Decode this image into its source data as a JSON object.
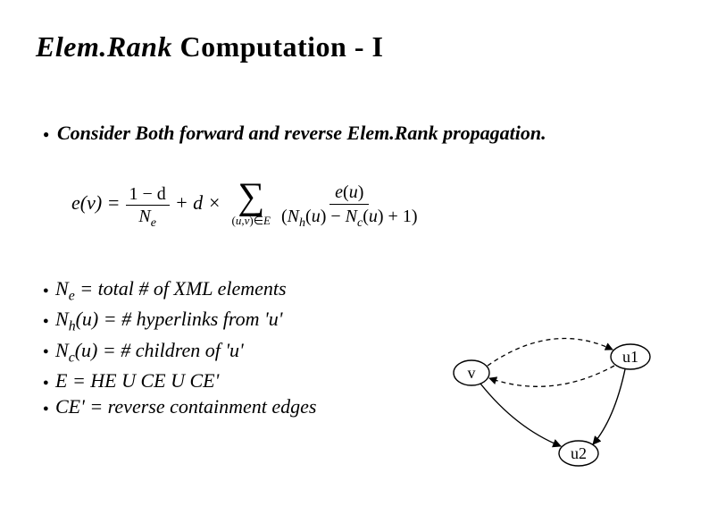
{
  "title": {
    "italic_part": "Elem.Rank",
    "rest": " Computation - I"
  },
  "subhead": "Consider Both forward and reverse Elem.Rank propagation.",
  "equation": {
    "lhs": "e(v) =",
    "frac1_num": "1 − d",
    "frac1_den": "Nₑ",
    "plus_d_times": "+ d ×",
    "sigma_sub": "(u,v)∈E",
    "frac2_num": "e(u)",
    "frac2_den": "(Nₕ(u) − N𝒸(u) + 1)"
  },
  "bullets": {
    "l1_pre": "N",
    "l1_sub": "e",
    "l1_post": " = total # of XML elements",
    "l2_pre": "N",
    "l2_sub": "h",
    "l2_post": "(u) = # hyperlinks from 'u'",
    "l3_pre": "N",
    "l3_sub": "c",
    "l3_post": "(u) = # children of 'u'",
    "l4": "E = HE  U  CE  U  CE'",
    "l5": "CE' = reverse containment edges"
  },
  "diagram": {
    "node_v": "v",
    "node_u1": "u1",
    "node_u2": "u2"
  }
}
